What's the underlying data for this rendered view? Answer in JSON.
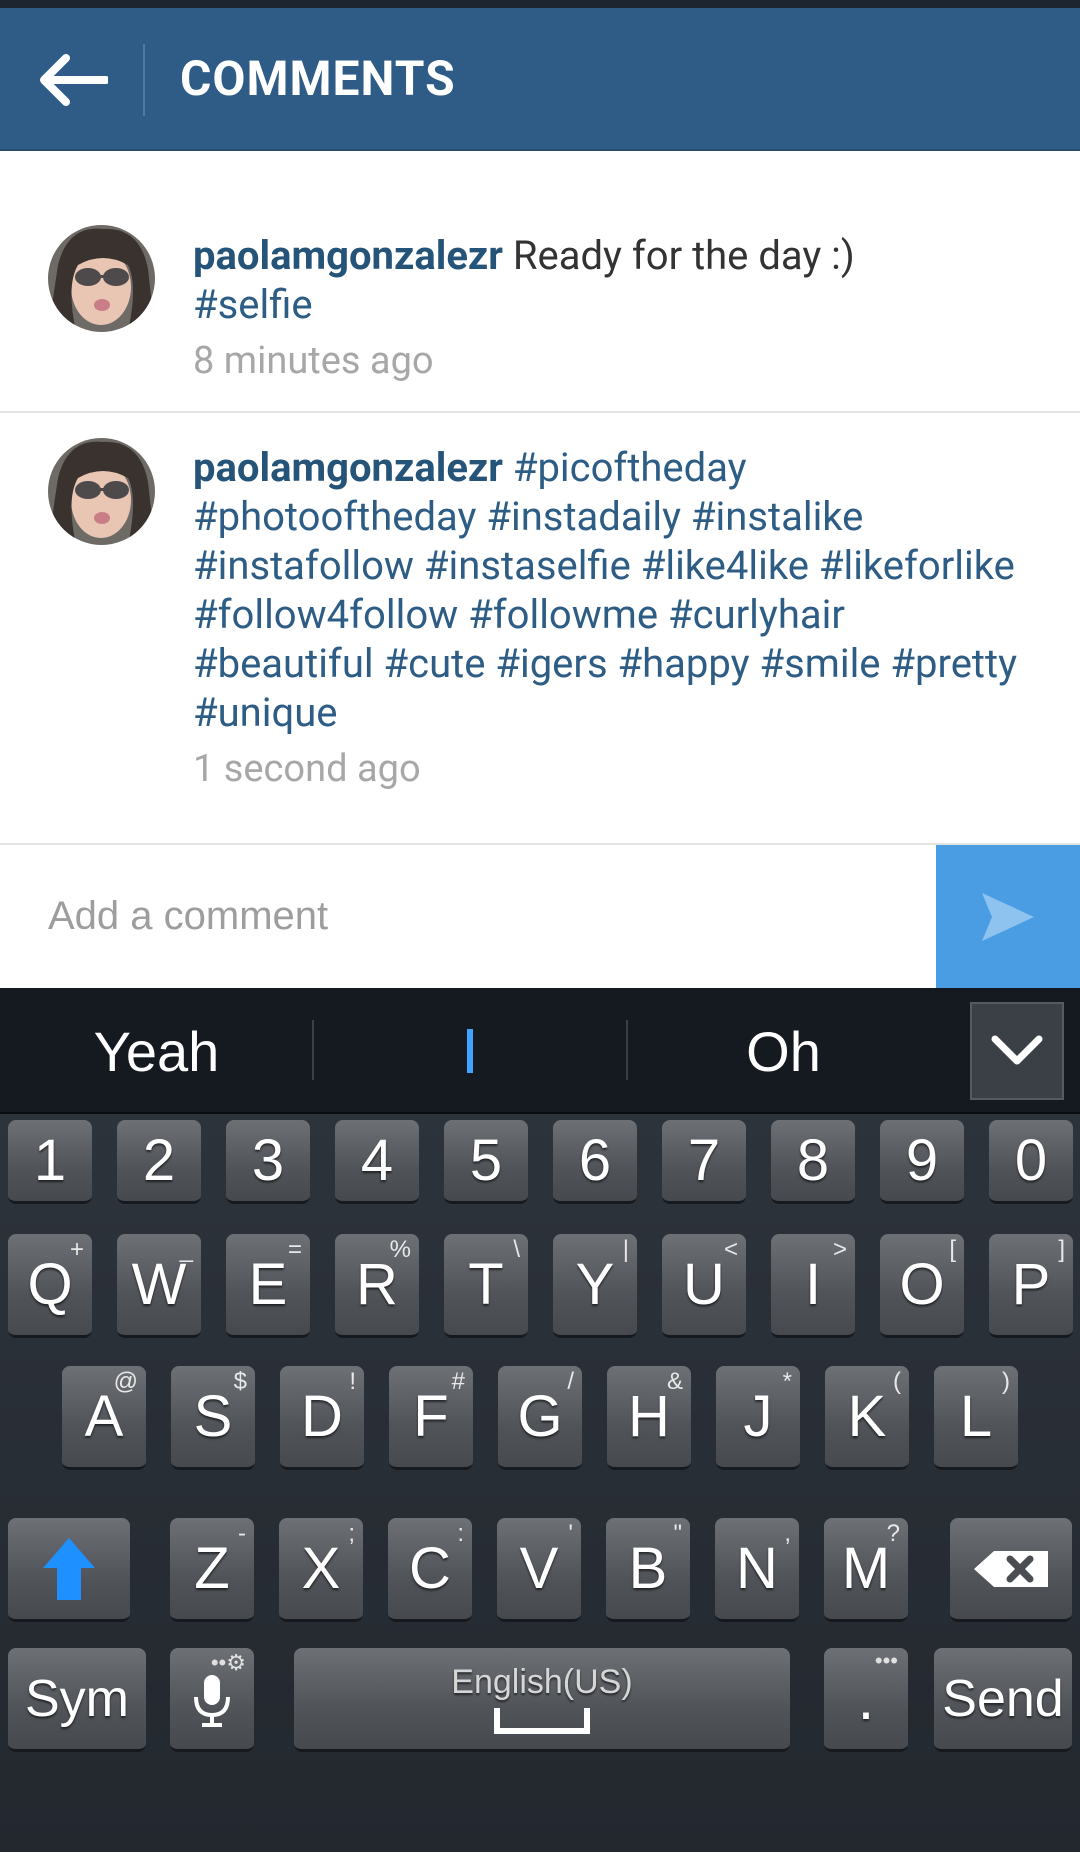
{
  "header": {
    "title": "COMMENTS"
  },
  "comments": [
    {
      "username": "paolamgonzalezr",
      "text": " Ready for the day :)",
      "tags": "#selfie",
      "timestamp": "8 minutes ago"
    },
    {
      "username": "paolamgonzalezr",
      "text": "",
      "tags": "#picoftheday #photooftheday #instadaily #instalike #instafollow #instaselfie #like4like #likeforlike #follow4follow #followme #curlyhair #beautiful #cute #igers #happy #smile #pretty #unique",
      "timestamp": "1 second ago"
    }
  ],
  "comment_input": {
    "placeholder": "Add a comment",
    "value": ""
  },
  "keyboard": {
    "suggestions": [
      "Yeah",
      "",
      "Oh"
    ],
    "number_row": [
      "1",
      "2",
      "3",
      "4",
      "5",
      "6",
      "7",
      "8",
      "9",
      "0"
    ],
    "row1": [
      {
        "key": "Q",
        "sub": "+"
      },
      {
        "key": "W",
        "sub": "_"
      },
      {
        "key": "E",
        "sub": "="
      },
      {
        "key": "R",
        "sub": "%"
      },
      {
        "key": "T",
        "sub": "\\"
      },
      {
        "key": "Y",
        "sub": "|"
      },
      {
        "key": "U",
        "sub": "<"
      },
      {
        "key": "I",
        "sub": ">"
      },
      {
        "key": "O",
        "sub": "["
      },
      {
        "key": "P",
        "sub": "]"
      }
    ],
    "row2": [
      {
        "key": "A",
        "sub": "@"
      },
      {
        "key": "S",
        "sub": "$"
      },
      {
        "key": "D",
        "sub": "!"
      },
      {
        "key": "F",
        "sub": "#"
      },
      {
        "key": "G",
        "sub": "/"
      },
      {
        "key": "H",
        "sub": "&"
      },
      {
        "key": "J",
        "sub": "*"
      },
      {
        "key": "K",
        "sub": "("
      },
      {
        "key": "L",
        "sub": ")"
      }
    ],
    "row3": [
      {
        "key": "Z",
        "sub": "-"
      },
      {
        "key": "X",
        "sub": ";"
      },
      {
        "key": "C",
        "sub": ":"
      },
      {
        "key": "V",
        "sub": "'"
      },
      {
        "key": "B",
        "sub": "\""
      },
      {
        "key": "N",
        "sub": ","
      },
      {
        "key": "M",
        "sub": "?"
      }
    ],
    "sym_label": "Sym",
    "space_label": "English(US)",
    "period_label": ".",
    "send_label": "Send"
  },
  "colors": {
    "header_bg": "#2e5c86",
    "username": "#255478",
    "hashtag": "#2d5c85",
    "send_button": "#4a9de3",
    "shift_arrow": "#1e90ff",
    "cursor": "#3fa5ff"
  },
  "icons": {
    "back": "back-arrow-icon",
    "send": "send-arrow-icon",
    "collapse": "chevron-down-icon",
    "shift": "shift-arrow-icon",
    "backspace": "backspace-icon",
    "mic": "microphone-icon",
    "settings": "gear-icon"
  }
}
